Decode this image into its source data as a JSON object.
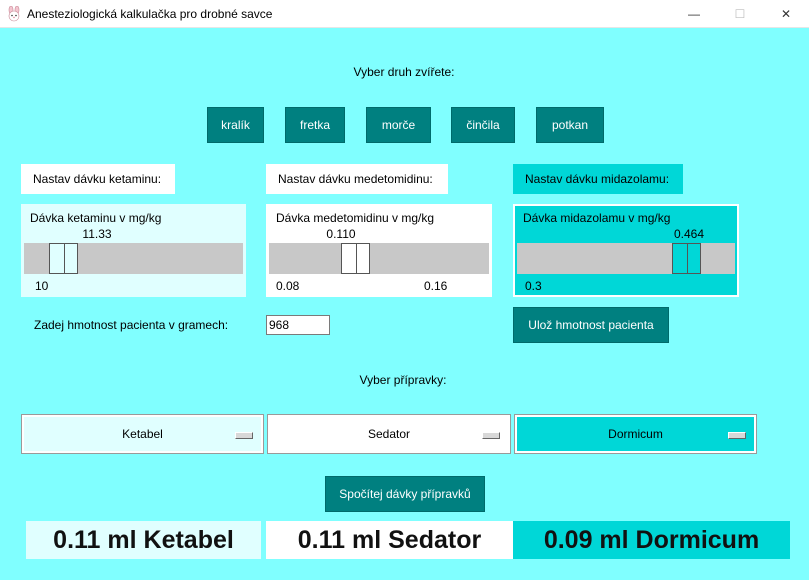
{
  "window": {
    "title": "Anesteziologická kalkulačka pro drobné savce",
    "minimize": "—",
    "maximize": "☐",
    "close": "✕"
  },
  "species": {
    "prompt": "Vyber druh zvířete:",
    "buttons": [
      "kralík",
      "fretka",
      "morče",
      "činčila",
      "potkan"
    ]
  },
  "ketamine": {
    "set_label": "Nastav dávku ketaminu:",
    "slider_title": "Dávka ketaminu v mg/kg",
    "value": "11.33",
    "min": "10",
    "max": "",
    "level": 0.13
  },
  "medetomidine": {
    "set_label": "Nastav dávku medetomidinu:",
    "slider_title": "Dávka medetomidinu v mg/kg",
    "value": "0.110",
    "min": "0.08",
    "max": "0.16",
    "level": 0.375
  },
  "midazolam": {
    "set_label": "Nastav dávku midazolamu:",
    "slider_title": "Dávka midazolamu v mg/kg",
    "value": "0.464",
    "min": "0.3",
    "max": "",
    "level": 0.82
  },
  "weight": {
    "label": "Zadej hmotnost pacienta v gramech:",
    "value": "968",
    "save_button": "Ulož hmotnost pacienta"
  },
  "preparations": {
    "prompt": "Vyber přípravky:",
    "ketamine_select": "Ketabel",
    "medetomidine_select": "Sedator",
    "midazolam_select": "Dormicum",
    "compute_button": "Spočítej dávky přípravků"
  },
  "results": {
    "ketamine": "0.11 ml Ketabel",
    "medetomidine": "0.11 ml Sedator",
    "midazolam": "0.09 ml Dormicum"
  },
  "colors": {
    "background": "#80ffff",
    "button": "#008080",
    "ketamine_panel": "#e0ffff",
    "medetomidine_panel": "#ffffff",
    "midazolam_panel": "#00d7d7"
  }
}
